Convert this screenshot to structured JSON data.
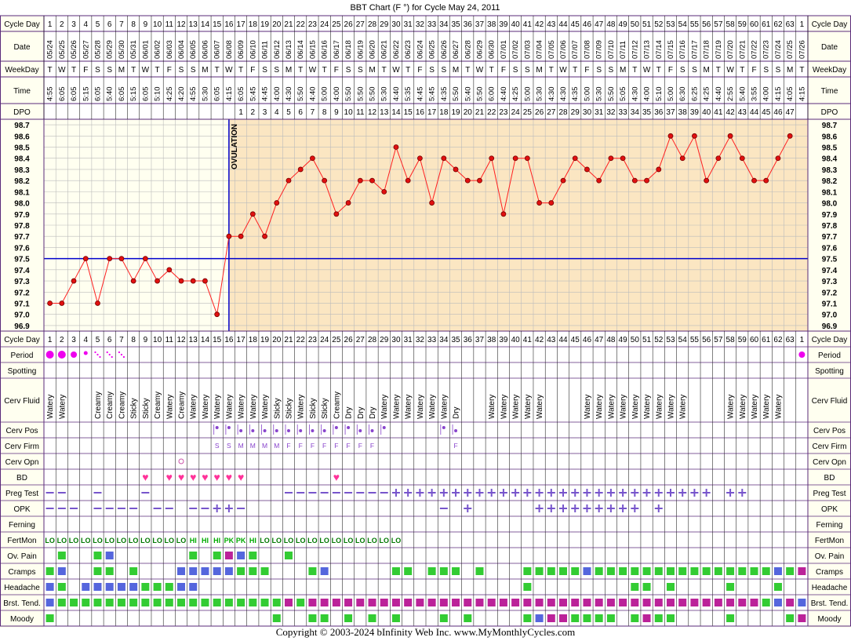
{
  "chart_data": {
    "type": "line",
    "title": "BBT Chart (F °) for Cycle May 24, 2011",
    "ylim": [
      96.9,
      98.7
    ],
    "y_ticks": [
      "98.7",
      "98.6",
      "98.5",
      "98.4",
      "98.3",
      "98.2",
      "98.1",
      "98.0",
      "97.9",
      "97.8",
      "97.7",
      "97.6",
      "97.5",
      "97.4",
      "97.3",
      "97.2",
      "97.1",
      "97.0",
      "96.9"
    ],
    "coverline": 97.5,
    "ovulation_day": 16,
    "ovulation_label": "OVULATION",
    "cycle_days": [
      "1",
      "2",
      "3",
      "4",
      "5",
      "6",
      "7",
      "8",
      "9",
      "10",
      "11",
      "12",
      "13",
      "14",
      "15",
      "16",
      "17",
      "18",
      "19",
      "20",
      "21",
      "22",
      "23",
      "24",
      "25",
      "26",
      "27",
      "28",
      "29",
      "30",
      "31",
      "32",
      "33",
      "34",
      "35",
      "36",
      "37",
      "38",
      "39",
      "40",
      "41",
      "42",
      "43",
      "44",
      "45",
      "46",
      "47",
      "48",
      "49",
      "50",
      "51",
      "52",
      "53",
      "54",
      "55",
      "56",
      "57",
      "58",
      "59",
      "60",
      "61",
      "62",
      "63",
      "1"
    ],
    "dates": [
      "05/24",
      "05/25",
      "05/26",
      "05/27",
      "05/28",
      "05/29",
      "05/30",
      "05/31",
      "06/01",
      "06/02",
      "06/03",
      "06/04",
      "06/05",
      "06/06",
      "06/07",
      "06/08",
      "06/09",
      "06/10",
      "06/11",
      "06/12",
      "06/13",
      "06/14",
      "06/15",
      "06/16",
      "06/17",
      "06/18",
      "06/19",
      "06/20",
      "06/21",
      "06/22",
      "06/23",
      "06/24",
      "06/25",
      "06/26",
      "06/27",
      "06/28",
      "06/29",
      "06/30",
      "07/01",
      "07/02",
      "07/03",
      "07/04",
      "07/05",
      "07/06",
      "07/07",
      "07/08",
      "07/09",
      "07/10",
      "07/11",
      "07/12",
      "07/13",
      "07/14",
      "07/15",
      "07/16",
      "07/17",
      "07/18",
      "07/19",
      "07/20",
      "07/21",
      "07/22",
      "07/23",
      "07/24",
      "07/25",
      "07/26"
    ],
    "weekdays": [
      "T",
      "W",
      "T",
      "F",
      "S",
      "S",
      "M",
      "T",
      "W",
      "T",
      "F",
      "S",
      "S",
      "M",
      "T",
      "W",
      "T",
      "F",
      "S",
      "S",
      "M",
      "T",
      "W",
      "T",
      "F",
      "S",
      "S",
      "M",
      "T",
      "W",
      "T",
      "F",
      "S",
      "S",
      "M",
      "T",
      "W",
      "T",
      "F",
      "S",
      "S",
      "M",
      "T",
      "W",
      "T",
      "F",
      "S",
      "S",
      "M",
      "T",
      "W",
      "T",
      "F",
      "S",
      "S",
      "M",
      "T",
      "W",
      "T",
      "F",
      "S",
      "S",
      "M",
      "T"
    ],
    "times": [
      "4:55",
      "6:05",
      "6:05",
      "5:15",
      "6:05",
      "5:40",
      "6:05",
      "5:15",
      "6:05",
      "5:10",
      "4:25",
      "4:20",
      "4:55",
      "5:30",
      "6:05",
      "4:15",
      "6:05",
      "5:45",
      "4:45",
      "4:00",
      "4:30",
      "5:50",
      "4:40",
      "5:00",
      "4:00",
      "5:50",
      "5:50",
      "5:50",
      "5:30",
      "4:40",
      "5:35",
      "4:45",
      "5:45",
      "4:35",
      "5:50",
      "5:40",
      "5:50",
      "6:00",
      "4:40",
      "4:25",
      "5:00",
      "5:30",
      "4:30",
      "4:30",
      "4:35",
      "5:00",
      "5:30",
      "5:50",
      "5:05",
      "4:30",
      "4:00",
      "5:10",
      "5:00",
      "6:30",
      "6:25",
      "4:25",
      "4:40",
      "2:55",
      "5:40",
      "3:55",
      "4:00",
      "4:15",
      "4:05",
      "4:15"
    ],
    "dpo": [
      "",
      "",
      "",
      "",
      "",
      "",
      "",
      "",
      "",
      "",
      "",
      "",
      "",
      "",
      "",
      "",
      "1",
      "2",
      "3",
      "4",
      "5",
      "6",
      "7",
      "8",
      "9",
      "10",
      "11",
      "12",
      "13",
      "14",
      "15",
      "16",
      "17",
      "18",
      "19",
      "20",
      "21",
      "22",
      "23",
      "24",
      "25",
      "26",
      "27",
      "28",
      "29",
      "30",
      "31",
      "32",
      "33",
      "34",
      "35",
      "36",
      "37",
      "38",
      "39",
      "40",
      "41",
      "42",
      "43",
      "44",
      "45",
      "46",
      "47",
      ""
    ],
    "temps": [
      97.1,
      97.1,
      97.3,
      97.5,
      97.1,
      97.5,
      97.5,
      97.3,
      97.5,
      97.3,
      97.4,
      97.3,
      97.3,
      97.3,
      97.0,
      97.7,
      97.7,
      97.9,
      97.7,
      98.0,
      98.2,
      98.3,
      98.4,
      98.2,
      97.9,
      98.0,
      98.2,
      98.2,
      98.1,
      98.5,
      98.2,
      98.4,
      98.0,
      98.4,
      98.3,
      98.2,
      98.2,
      98.4,
      97.9,
      98.4,
      98.4,
      98.0,
      98.0,
      98.2,
      98.4,
      98.3,
      98.2,
      98.4,
      98.4,
      98.2,
      98.2,
      98.3,
      98.6,
      98.4,
      98.6,
      98.2,
      98.4,
      98.6,
      98.4,
      98.2,
      98.2,
      98.4,
      98.6,
      null
    ],
    "header_labels": {
      "cycle_day": "Cycle Day",
      "date": "Date",
      "weekday": "WeekDay",
      "time": "Time",
      "dpo": "DPO"
    },
    "rows": [
      {
        "key": "period",
        "label": "Period",
        "type": "period",
        "data": {
          "1": "L",
          "2": "L",
          "3": "M",
          "4": "S",
          "5": "D",
          "6": "D",
          "7": "D",
          "64": "M"
        }
      },
      {
        "key": "spotting",
        "label": "Spotting",
        "type": "text",
        "data": {}
      },
      {
        "key": "cerv_fluid",
        "label": "Cerv Fluid",
        "type": "vtext",
        "data": {
          "1": "Watery",
          "2": "Watery",
          "5": "Creamy",
          "6": "Creamy",
          "7": "Creamy",
          "8": "Sticky",
          "9": "Sticky",
          "10": "Creamy",
          "11": "Watery",
          "12": "Creamy",
          "13": "Watery",
          "14": "Watery",
          "15": "Watery",
          "16": "Watery",
          "17": "Watery",
          "18": "Watery",
          "19": "Watery",
          "20": "Sticky",
          "21": "Sticky",
          "22": "Watery",
          "23": "Sticky",
          "24": "Sticky",
          "25": "Creamy",
          "26": "Dry",
          "27": "Dry",
          "28": "Dry",
          "29": "Watery",
          "30": "Watery",
          "31": "Watery",
          "32": "Watery",
          "33": "Watery",
          "34": "Watery",
          "35": "Dry",
          "38": "Watery",
          "39": "Watery",
          "40": "Watery",
          "41": "Watery",
          "42": "Watery",
          "46": "Watery",
          "47": "Watery",
          "48": "Watery",
          "49": "Watery",
          "50": "Watery",
          "51": "Watery",
          "52": "Watery",
          "53": "Watery",
          "54": "Watery",
          "58": "Watery",
          "59": "Watery",
          "60": "Watery",
          "61": "Watery",
          "62": "Watery"
        }
      },
      {
        "key": "cerv_pos",
        "label": "Cerv Pos",
        "type": "cervpos",
        "data": {
          "15": "H",
          "16": "H",
          "17": "M",
          "18": "M",
          "19": "M",
          "20": "M",
          "21": "M",
          "22": "M",
          "23": "M",
          "24": "M",
          "25": "H",
          "26": "H",
          "27": "M",
          "28": "M",
          "29": "H",
          "34": "H",
          "35": "M"
        }
      },
      {
        "key": "cerv_firm",
        "label": "Cerv Firm",
        "type": "text",
        "data": {
          "15": "S",
          "16": "S",
          "17": "M",
          "18": "M",
          "19": "M",
          "20": "M",
          "21": "F",
          "22": "F",
          "23": "F",
          "24": "F",
          "25": "F",
          "26": "F",
          "27": "F",
          "28": "F",
          "35": "F"
        }
      },
      {
        "key": "cerv_opn",
        "label": "Cerv Opn",
        "type": "circle",
        "data": {
          "12": "O"
        }
      },
      {
        "key": "bd",
        "label": "BD",
        "type": "heart",
        "data": {
          "9": "Y",
          "11": "Y",
          "12": "Y",
          "13": "Y",
          "14": "Y",
          "15": "Y",
          "16": "Y",
          "17": "Y",
          "25": "Y"
        }
      },
      {
        "key": "preg_test",
        "label": "Preg Test",
        "type": "test",
        "data": {
          "1": "-",
          "2": "-",
          "5": "-",
          "9": "-",
          "21": "-",
          "22": "-",
          "23": "-",
          "24": "-",
          "25": "-",
          "26": "-",
          "27": "-",
          "28": "-",
          "29": "-",
          "30": "+",
          "31": "+",
          "32": "+",
          "33": "+",
          "34": "+",
          "35": "+",
          "36": "+",
          "37": "+",
          "38": "+",
          "39": "+",
          "40": "+",
          "41": "+",
          "42": "+",
          "43": "+",
          "44": "+",
          "45": "+",
          "46": "+",
          "47": "+",
          "48": "+",
          "49": "+",
          "50": "+",
          "51": "+",
          "52": "+",
          "53": "+",
          "54": "+",
          "55": "+",
          "56": "+",
          "58": "+",
          "59": "+"
        }
      },
      {
        "key": "opk",
        "label": "OPK",
        "type": "test",
        "data": {
          "1": "-",
          "2": "-",
          "3": "-",
          "5": "-",
          "6": "-",
          "7": "-",
          "8": "-",
          "10": "-",
          "11": "-",
          "13": "-",
          "14": "-",
          "15": "+",
          "16": "+",
          "17": "-",
          "34": "-",
          "36": "+",
          "42": "+",
          "43": "+",
          "44": "+",
          "45": "+",
          "46": "+",
          "47": "+",
          "48": "+",
          "49": "+",
          "50": "+",
          "52": "+"
        }
      },
      {
        "key": "ferning",
        "label": "Ferning",
        "type": "text",
        "data": {}
      },
      {
        "key": "fertmon",
        "label": "FertMon",
        "type": "fert",
        "data": {
          "1": "LO",
          "2": "LO",
          "3": "LO",
          "4": "LO",
          "5": "LO",
          "6": "LO",
          "7": "LO",
          "8": "LO",
          "9": "LO",
          "10": "LO",
          "11": "LO",
          "12": "LO",
          "13": "HI",
          "14": "HI",
          "15": "HI",
          "16": "PK",
          "17": "PK",
          "18": "HI",
          "19": "LO",
          "20": "LO",
          "21": "LO",
          "22": "LO",
          "23": "LO",
          "24": "LO",
          "25": "LO",
          "26": "LO",
          "27": "LO",
          "28": "LO",
          "29": "LO",
          "30": "LO"
        }
      },
      {
        "key": "ov_pain",
        "label": "Ov. Pain",
        "type": "sq",
        "data": {
          "2": "G",
          "5": "G",
          "6": "B",
          "13": "G",
          "15": "G",
          "16": "P",
          "17": "B",
          "18": "G",
          "21": "G"
        }
      },
      {
        "key": "cramps",
        "label": "Cramps",
        "type": "sq",
        "data": {
          "1": "G",
          "2": "B",
          "5": "G",
          "6": "G",
          "8": "G",
          "12": "B",
          "13": "B",
          "14": "B",
          "15": "B",
          "16": "B",
          "17": "G",
          "18": "G",
          "19": "G",
          "23": "G",
          "24": "B",
          "30": "G",
          "31": "G",
          "33": "G",
          "34": "G",
          "35": "G",
          "37": "G",
          "41": "G",
          "42": "G",
          "43": "G",
          "44": "G",
          "45": "G",
          "46": "B",
          "47": "G",
          "48": "G",
          "49": "G",
          "50": "G",
          "51": "G",
          "52": "G",
          "53": "G",
          "54": "G",
          "55": "G",
          "56": "G",
          "57": "G",
          "58": "G",
          "59": "G",
          "60": "G",
          "61": "G",
          "62": "B",
          "63": "G",
          "64": "P"
        }
      },
      {
        "key": "headache",
        "label": "Headache",
        "type": "sq",
        "data": {
          "1": "B",
          "2": "G",
          "4": "B",
          "5": "B",
          "6": "B",
          "7": "B",
          "8": "B",
          "9": "G",
          "10": "G",
          "11": "G",
          "12": "B",
          "13": "B",
          "41": "G",
          "50": "G",
          "51": "G",
          "53": "G",
          "58": "G",
          "62": "G"
        }
      },
      {
        "key": "brst_tend",
        "label": "Brst. Tend.",
        "type": "sq",
        "data": {
          "1": "B",
          "2": "G",
          "3": "G",
          "4": "G",
          "5": "G",
          "6": "G",
          "7": "G",
          "8": "G",
          "9": "G",
          "10": "G",
          "11": "G",
          "12": "G",
          "13": "G",
          "14": "G",
          "15": "G",
          "16": "G",
          "17": "G",
          "18": "G",
          "19": "G",
          "20": "G",
          "21": "P",
          "22": "G",
          "23": "P",
          "24": "P",
          "25": "P",
          "26": "P",
          "27": "P",
          "28": "P",
          "29": "P",
          "30": "P",
          "31": "P",
          "32": "P",
          "33": "P",
          "34": "P",
          "35": "P",
          "36": "P",
          "37": "P",
          "38": "P",
          "39": "P",
          "40": "P",
          "41": "P",
          "42": "P",
          "43": "P",
          "44": "P",
          "45": "P",
          "46": "P",
          "47": "P",
          "48": "P",
          "49": "P",
          "50": "P",
          "51": "P",
          "52": "P",
          "53": "P",
          "54": "P",
          "55": "P",
          "56": "P",
          "57": "P",
          "58": "P",
          "59": "P",
          "60": "P",
          "61": "G",
          "62": "B",
          "63": "P",
          "64": "B"
        }
      },
      {
        "key": "moody",
        "label": "Moody",
        "type": "sq",
        "data": {
          "1": "G",
          "20": "G",
          "23": "G",
          "24": "G",
          "26": "G",
          "28": "G",
          "30": "G",
          "34": "G",
          "36": "G",
          "41": "G",
          "42": "B",
          "43": "P",
          "44": "P",
          "45": "G",
          "46": "G",
          "47": "G",
          "48": "G",
          "50": "G",
          "51": "P",
          "52": "G",
          "53": "G",
          "58": "G",
          "63": "G",
          "64": "P"
        }
      }
    ]
  },
  "colors": {
    "border": "#5a2a7a",
    "label_bg": "#fffff0",
    "pre_ov_bg": "#fffff0",
    "post_ov_bg": "#fbe6c2",
    "grid": "#bbbbbb",
    "temp_line": "#ff2020",
    "temp_dot": "#e01010",
    "coverline": "#0000cc",
    "ovulation": "#0000cc",
    "period": "#ee00ee",
    "sq_green": "#33cc33",
    "sq_blue": "#5566dd",
    "sq_purple": "#bb2299",
    "heart": "#ff3399",
    "test_sign": "#7755cc",
    "fert_lo": "#007700",
    "fert_hi": "#00aa00",
    "fert_pk": "#00aa00",
    "cerv_text": "#8844cc"
  },
  "footer": {
    "copyright": "Copyright © 2003-2024 bInfinity Web Inc.     www.MyMonthlyCycles.com"
  }
}
